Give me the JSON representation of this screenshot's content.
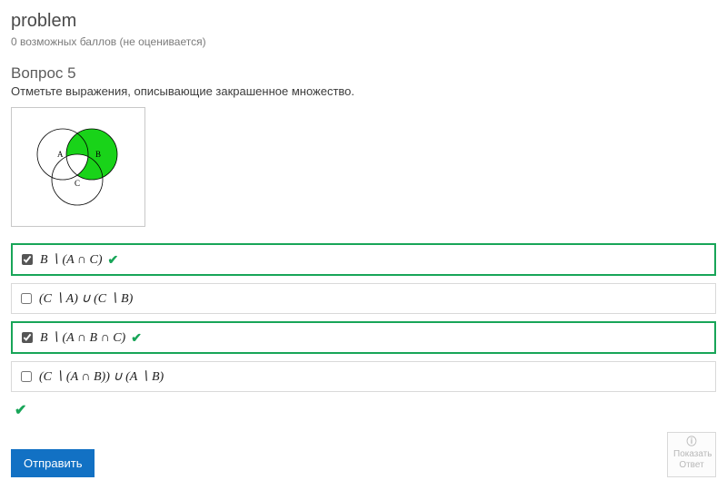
{
  "header": {
    "title": "problem",
    "subtitle": "0 возможных баллов (не оценивается)"
  },
  "question": {
    "heading": "Вопрос 5",
    "prompt": "Отметьте выражения, описывающие закрашенное множество."
  },
  "venn": {
    "labelA": "A",
    "labelB": "B",
    "labelC": "C"
  },
  "choices": [
    {
      "label": "B ∖ (A ∩ C)",
      "checked": true,
      "correct": true
    },
    {
      "label": "(C ∖ A) ∪ (C ∖ B)",
      "checked": false,
      "correct": false
    },
    {
      "label": "B ∖ (A ∩ B ∩ C)",
      "checked": true,
      "correct": true
    },
    {
      "label": "(C ∖ (A ∩ B)) ∪ (A ∖ B)",
      "checked": false,
      "correct": false
    }
  ],
  "overall_correct": true,
  "buttons": {
    "submit": "Отправить",
    "show_answer_line1": "Показать",
    "show_answer_line2": "Ответ"
  },
  "icons": {
    "check": "✔",
    "info": "ⓘ"
  }
}
